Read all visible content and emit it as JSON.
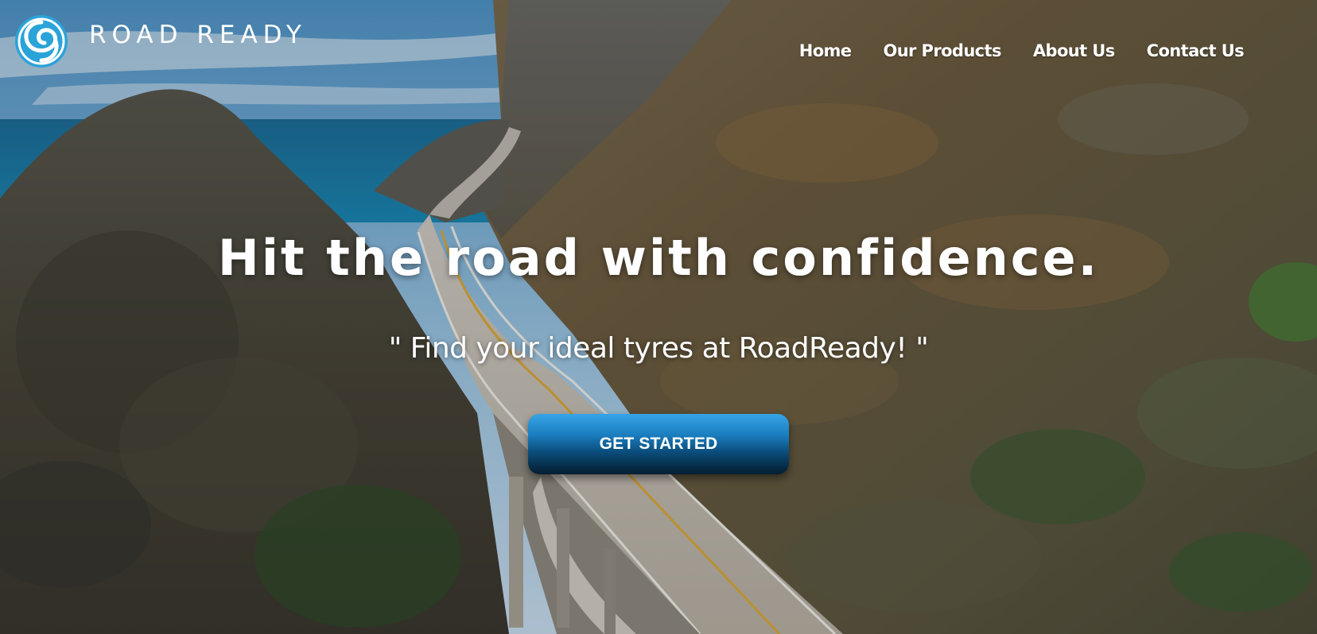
{
  "brand": {
    "name": "ROAD READY",
    "logo_icon": "swirl-logo-icon",
    "logo_color": "#2aa3d8"
  },
  "nav": {
    "items": [
      {
        "label": "Home"
      },
      {
        "label": "Our Products"
      },
      {
        "label": "About Us"
      },
      {
        "label": "Contact Us"
      }
    ]
  },
  "hero": {
    "headline": "Hit the road with confidence.",
    "tagline": "\" Find your ideal tyres at RoadReady! \"",
    "cta_label": "GET STARTED",
    "cta_color": "#1b7fc0"
  }
}
